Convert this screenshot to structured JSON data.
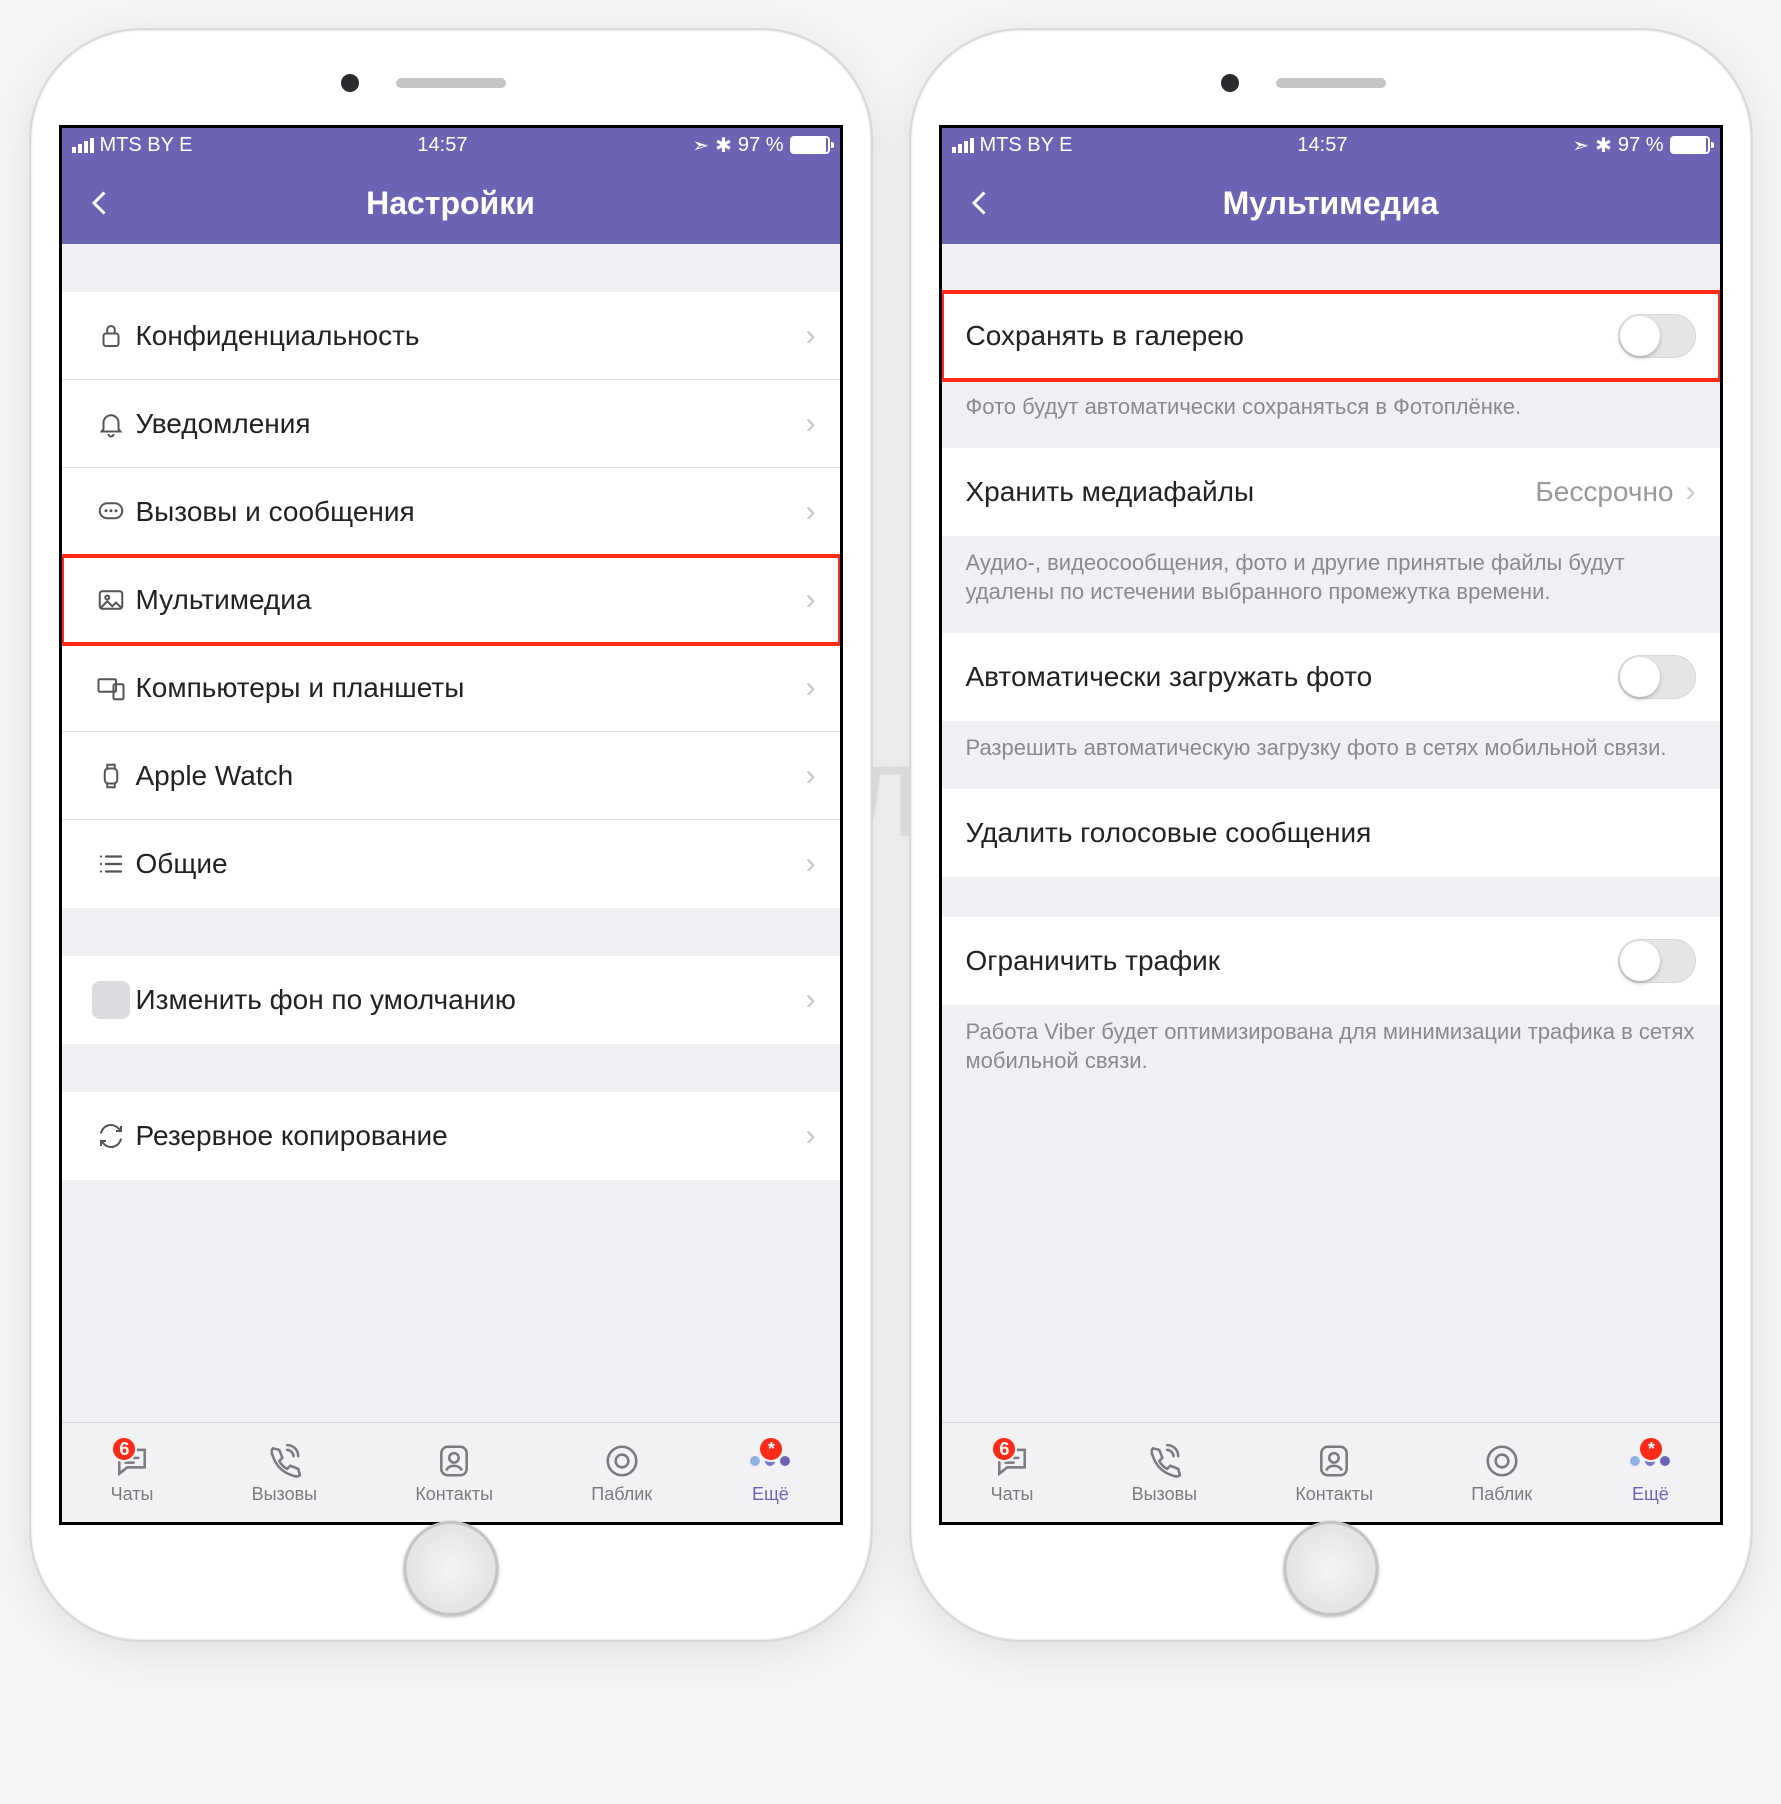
{
  "status": {
    "carrier": "MTS BY  E",
    "time": "14:57",
    "battery": "97 %",
    "location_glyph": "➣",
    "bt_glyph": "✱"
  },
  "watermark": "ЯБЛЫК",
  "left": {
    "title": "Настройки",
    "items": [
      {
        "label": "Конфиденциальность"
      },
      {
        "label": "Уведомления"
      },
      {
        "label": "Вызовы и сообщения"
      },
      {
        "label": "Мультимедиа"
      },
      {
        "label": "Компьютеры и планшеты"
      },
      {
        "label": "Apple Watch"
      },
      {
        "label": "Общие"
      }
    ],
    "wallpaper": {
      "label": "Изменить фон по умолчанию"
    },
    "backup": {
      "label": "Резервное копирование"
    }
  },
  "right": {
    "title": "Мультимедиа",
    "save_gallery": {
      "label": "Сохранять в галерею",
      "footer": "Фото будут автоматически сохраняться в Фотоплёнке."
    },
    "keep_media": {
      "label": "Хранить медиафайлы",
      "value": "Бессрочно",
      "footer": "Аудио-, видеосообщения, фото и другие принятые файлы будут удалены по истечении выбранного промежутка времени."
    },
    "auto_photo": {
      "label": "Автоматически загружать фото",
      "footer": "Разрешить автоматическую загрузку фото в сетях мобильной связи."
    },
    "delete_voice": {
      "label": "Удалить голосовые сообщения"
    },
    "limit_traffic": {
      "label": "Ограничить трафик",
      "footer": "Работа Viber будет оптимизирована для минимизации трафика в сетях мобильной связи."
    }
  },
  "tabs": {
    "chats": "Чаты",
    "calls": "Вызовы",
    "contacts": "Контакты",
    "public": "Паблик",
    "more": "Ещё",
    "chat_badge": "6",
    "more_badge": "*"
  }
}
